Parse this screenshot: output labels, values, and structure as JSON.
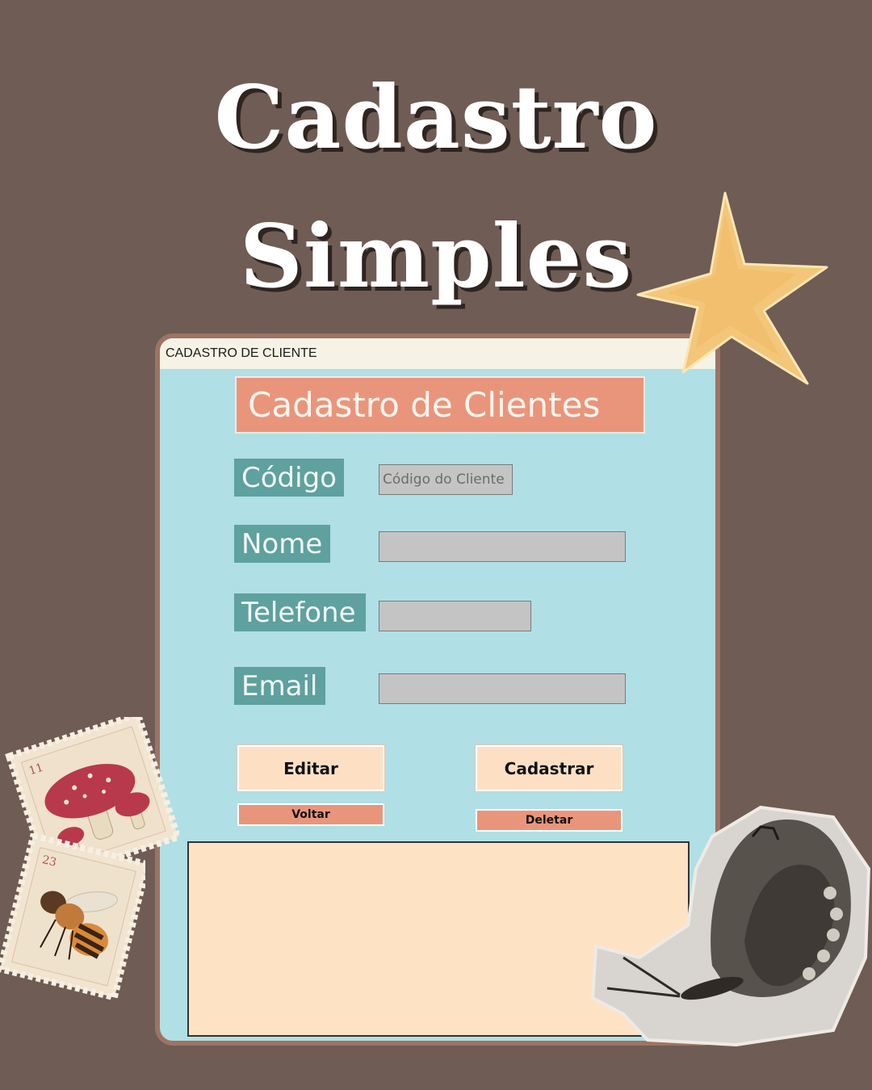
{
  "headline": {
    "line1": "Cadastro",
    "line2": "Simples"
  },
  "window": {
    "title": "CADASTRO DE CLIENTE"
  },
  "form": {
    "heading": "Cadastro de Clientes",
    "fields": {
      "codigo": {
        "label": "Código",
        "placeholder": "Código do Cliente",
        "value": ""
      },
      "nome": {
        "label": "Nome",
        "value": ""
      },
      "telefone": {
        "label": "Telefone",
        "value": ""
      },
      "email": {
        "label": "Email",
        "value": ""
      }
    },
    "buttons": {
      "editar": "Editar",
      "cadastrar": "Cadastrar",
      "voltar": "Voltar",
      "deletar": "Deletar"
    }
  },
  "stamps": {
    "mushroom_number": "11",
    "bee_number": "23"
  },
  "colors": {
    "background": "#6e5c55",
    "window_bg": "#b0dfe5",
    "label_bg": "#5ea19f",
    "accent": "#e9957b",
    "button_bg": "#fde0c4"
  },
  "icons": [
    "star-sticker-icon",
    "mushroom-stamp-icon",
    "bee-stamp-icon",
    "butterfly-sticker-icon"
  ]
}
